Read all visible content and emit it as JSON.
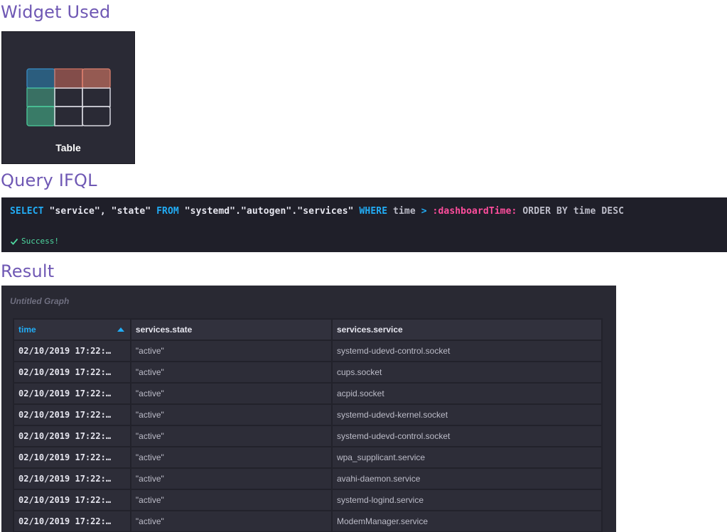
{
  "sections": {
    "widget_heading": "Widget Used",
    "query_heading": "Query IFQL",
    "result_heading": "Result"
  },
  "widget": {
    "label": "Table",
    "icon": "table-icon"
  },
  "query": {
    "tokens": [
      {
        "t": "SELECT",
        "c": "kw"
      },
      {
        "t": " \"service\", \"state\" ",
        "c": ""
      },
      {
        "t": "FROM",
        "c": "kw"
      },
      {
        "t": " \"systemd\".\"autogen\".\"services\" ",
        "c": ""
      },
      {
        "t": "WHERE",
        "c": "kw"
      },
      {
        "t": " time ",
        "c": "dim"
      },
      {
        "t": ">",
        "c": "op"
      },
      {
        "t": " :dashboardTime:",
        "c": "var"
      },
      {
        "t": " ORDER BY time DESC",
        "c": "dim"
      }
    ],
    "status": "Success!",
    "status_icon": "check-icon"
  },
  "result": {
    "graph_title": "Untitled Graph",
    "columns": [
      "time",
      "services.state",
      "services.service"
    ],
    "sorted_column": "time",
    "rows": [
      {
        "time": "02/10/2019 17:22:…",
        "state": "\"active\"",
        "service": "systemd-udevd-control.socket"
      },
      {
        "time": "02/10/2019 17:22:…",
        "state": "\"active\"",
        "service": "cups.socket"
      },
      {
        "time": "02/10/2019 17:22:…",
        "state": "\"active\"",
        "service": "acpid.socket"
      },
      {
        "time": "02/10/2019 17:22:…",
        "state": "\"active\"",
        "service": "systemd-udevd-kernel.socket"
      },
      {
        "time": "02/10/2019 17:22:…",
        "state": "\"active\"",
        "service": "systemd-udevd-control.socket"
      },
      {
        "time": "02/10/2019 17:22:…",
        "state": "\"active\"",
        "service": "wpa_supplicant.service"
      },
      {
        "time": "02/10/2019 17:22:…",
        "state": "\"active\"",
        "service": "avahi-daemon.service"
      },
      {
        "time": "02/10/2019 17:22:…",
        "state": "\"active\"",
        "service": "systemd-logind.service"
      },
      {
        "time": "02/10/2019 17:22:…",
        "state": "\"active\"",
        "service": "ModemManager.service"
      }
    ]
  }
}
